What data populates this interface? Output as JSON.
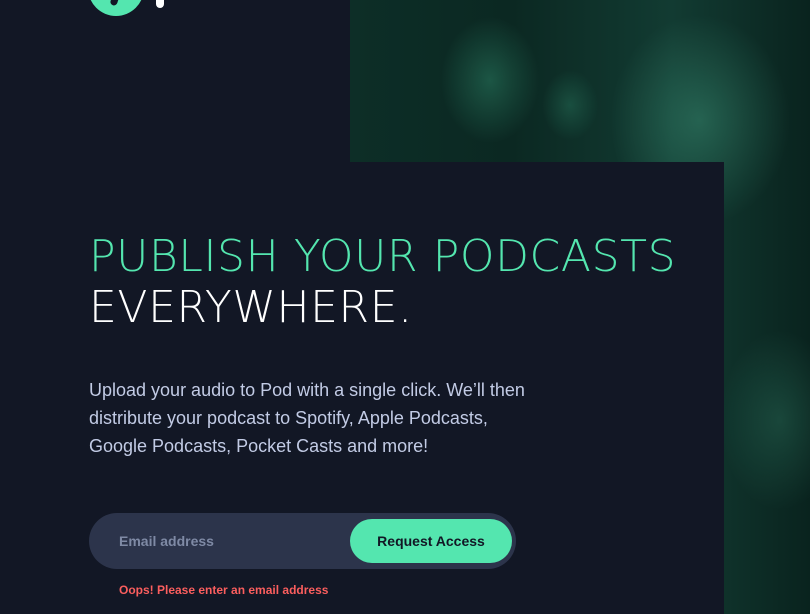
{
  "brand": {
    "accent_color": "#54e6af",
    "background_color": "#121725",
    "text_muted_color": "#c2cbe5",
    "error_color": "#fb5e5e"
  },
  "header": {
    "logo_icon": "pod-logo-icon"
  },
  "hero": {
    "headline_accent": "PUBLISH YOUR PODCASTS",
    "headline_rest": "EVERYWHERE.",
    "description": "Upload your audio to Pod with a single click. We’ll then distribute your podcast to Spotify, Apple Podcasts, Google Podcasts, Pocket Casts and more!",
    "image_icon": "podcast-host-photo"
  },
  "signup": {
    "email_placeholder": "Email address",
    "email_value": "",
    "button_label": "Request Access",
    "error_message": "Oops! Please enter an email address"
  }
}
